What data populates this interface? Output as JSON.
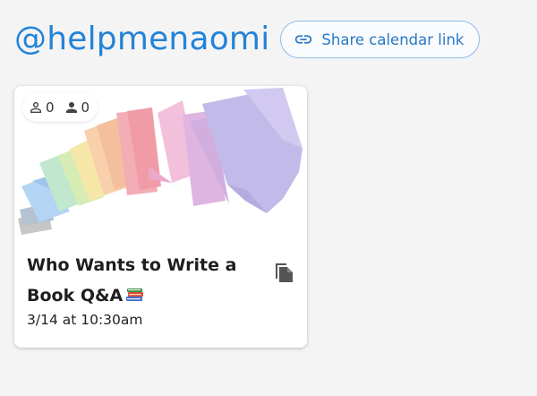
{
  "header": {
    "handle": "@helpmenaomi",
    "share_label": "Share calendar link",
    "share_icon": "link-icon"
  },
  "event_card": {
    "stats": {
      "attendees_outline": "0",
      "attendees_filled": "0",
      "outline_icon": "person-outline-icon",
      "filled_icon": "person-filled-icon"
    },
    "title": "Who Wants to Write a Book Q&A",
    "title_emoji": "books-emoji",
    "date": "3/14 at 10:30am",
    "copy_icon": "copy-icon"
  },
  "colors": {
    "accent": "#2383d8",
    "background": "#f4f4f5"
  }
}
